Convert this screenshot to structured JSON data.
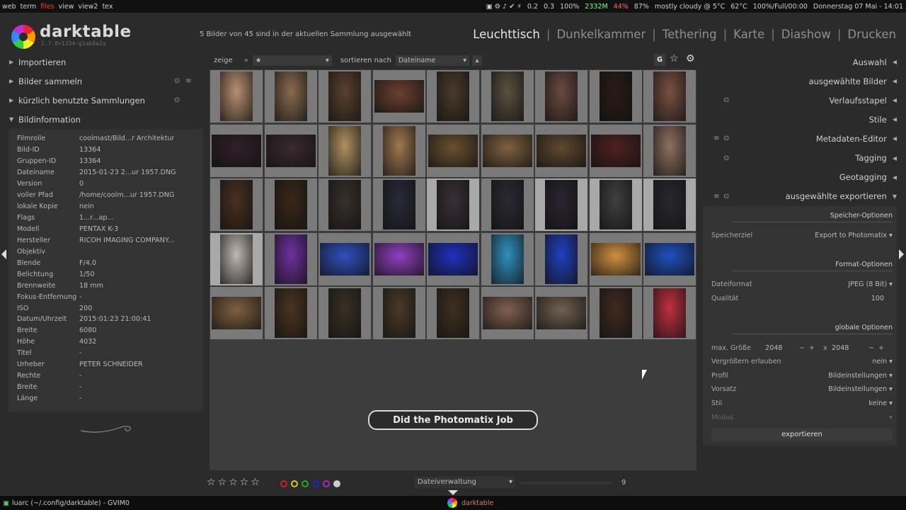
{
  "sysbar": {
    "workspaces": [
      "web",
      "term",
      "files",
      "view",
      "view2",
      "tex"
    ],
    "active_workspace": "files",
    "status": [
      "0.2",
      "0.3",
      "100%",
      "2332M",
      "44%",
      "87%",
      "mostly cloudy @ 5°C",
      "62°C",
      "100%/Full/00:00",
      "Donnerstag 07 Mai - 14:01"
    ]
  },
  "app": {
    "logo": "darktable",
    "version": "1.7.0+1334~g1ab8a2a",
    "count_text": "5 Bilder von 45 sind in der aktuellen Sammlung ausgewählt",
    "views": [
      "Leuchttisch",
      "Dunkelkammer",
      "Tethering",
      "Karte",
      "Diashow",
      "Drucken"
    ],
    "active_view": "Leuchttisch"
  },
  "left": {
    "modules": [
      {
        "label": "Importieren",
        "expanded": false
      },
      {
        "label": "Bilder sammeln",
        "expanded": false
      },
      {
        "label": "kürzlich benutzte Sammlungen",
        "expanded": false
      },
      {
        "label": "Bildinformation",
        "expanded": true
      }
    ],
    "info": [
      {
        "k": "Filmrolle",
        "v": "coolmast/Bild...r Architektur"
      },
      {
        "k": "Bild-ID",
        "v": "13364"
      },
      {
        "k": "Gruppen-ID",
        "v": "13364"
      },
      {
        "k": "Dateiname",
        "v": "2015-01-23 2...ur 1957.DNG"
      },
      {
        "k": "Version",
        "v": "0"
      },
      {
        "k": "voller Pfad",
        "v": "/home/coolm...ur 1957.DNG"
      },
      {
        "k": "lokale Kopie",
        "v": "nein"
      },
      {
        "k": "Flags",
        "v": "1...r...ap..."
      },
      {
        "k": "Modell",
        "v": "PENTAX K-3"
      },
      {
        "k": "Hersteller",
        "v": "RICOH IMAGING COMPANY..."
      },
      {
        "k": "Objektiv",
        "v": ""
      },
      {
        "k": "Blende",
        "v": "F/4.0"
      },
      {
        "k": "Belichtung",
        "v": "1/50"
      },
      {
        "k": "Brennweite",
        "v": "18 mm"
      },
      {
        "k": "Fokus-Entfernung",
        "v": "-"
      },
      {
        "k": "ISO",
        "v": "200"
      },
      {
        "k": "Datum/Uhrzeit",
        "v": "2015:01:23 21:00:41"
      },
      {
        "k": "Breite",
        "v": "6080"
      },
      {
        "k": "Höhe",
        "v": "4032"
      },
      {
        "k": "Titel",
        "v": "-"
      },
      {
        "k": "Urheber",
        "v": "PETER SCHNEIDER"
      },
      {
        "k": "Rechte",
        "v": "-"
      },
      {
        "k": "Breite",
        "v": "-"
      },
      {
        "k": "Länge",
        "v": "-"
      }
    ]
  },
  "filter": {
    "show_label": "zeige",
    "show_value": "★",
    "sort_label": "sortieren nach",
    "sort_value": "Dateiname",
    "grouping_button": "G"
  },
  "grid": {
    "columns": 9,
    "rows": 5,
    "tones": [
      [
        "#b89070",
        "#8a6a50",
        "#5a4030",
        "#6a4030",
        "#4a3a2a",
        "#5a5040",
        "#6a4a40",
        "#2a1a14",
        "#7a5040"
      ],
      [
        "#302028",
        "#3a2a30",
        "#b09060",
        "#a07850",
        "#6a5030",
        "#806040",
        "#604830",
        "#502020",
        "#907060"
      ],
      [
        "#4a3020",
        "#3a2818",
        "#38302a",
        "#2a2a3a",
        "#3a3038",
        "#2a2a34",
        "#2a2430",
        "#404040",
        "#2a2830"
      ],
      [
        "#c0b8b0",
        "#7030a0",
        "#3050c0",
        "#9040c0",
        "#2030c0",
        "#3090c0",
        "#2040c0",
        "#d09040",
        "#2050c0"
      ],
      [
        "#806040",
        "#4a3420",
        "#3a3024",
        "#4a3a28",
        "#403020",
        "#806050",
        "#706050",
        "#402a20",
        "#c03040"
      ]
    ],
    "portrait": [
      [
        true,
        true,
        true,
        false,
        true,
        true,
        true,
        true,
        true
      ],
      [
        false,
        false,
        true,
        true,
        false,
        false,
        false,
        false,
        true
      ],
      [
        true,
        true,
        true,
        true,
        true,
        true,
        true,
        true,
        true
      ],
      [
        true,
        true,
        false,
        false,
        false,
        true,
        true,
        false,
        false
      ],
      [
        false,
        true,
        true,
        true,
        true,
        false,
        false,
        true,
        true
      ]
    ],
    "selected": [
      [
        2,
        4
      ],
      [
        2,
        6
      ],
      [
        2,
        7
      ],
      [
        2,
        8
      ],
      [
        3,
        0
      ]
    ]
  },
  "overlay_text": "Did the Photomatix Job",
  "bottom": {
    "stars": "☆☆☆☆☆",
    "color_labels": [
      "#cc2222",
      "#cccc22",
      "#22aa22",
      "#2222cc",
      "#aa22cc",
      "#cccccc"
    ],
    "layout_value": "Dateiverwaltung",
    "zoom_value": "9"
  },
  "right": {
    "modules": [
      {
        "label": "Auswahl",
        "icons": ""
      },
      {
        "label": "ausgewählte Bilder",
        "icons": ""
      },
      {
        "label": "Verlaufsstapel",
        "icons": "dot"
      },
      {
        "label": "Stile",
        "icons": ""
      },
      {
        "label": "Metadaten-Editor",
        "icons": "both"
      },
      {
        "label": "Tagging",
        "icons": "dot"
      },
      {
        "label": "Geotagging",
        "icons": ""
      },
      {
        "label": "ausgewählte exportieren",
        "icons": "both",
        "expanded": true
      }
    ],
    "export": {
      "storage_section": "Speicher-Optionen",
      "target_label": "Speicherziel",
      "target_value": "Export to Photomatix",
      "format_section": "Format-Optionen",
      "format_label": "Dateiformat",
      "format_value": "JPEG (8 Bit)",
      "quality_label": "Qualität",
      "quality_value": "100",
      "global_section": "globale Optionen",
      "maxsize_label": "max. Größe",
      "maxsize_w": "2048",
      "maxsize_x": "x",
      "maxsize_h": "2048",
      "upscale_label": "Vergrößern erlauben",
      "upscale_value": "nein",
      "profile_label": "Profil",
      "profile_value": "Bildeinstellungen",
      "intent_label": "Vorsatz",
      "intent_value": "Bildeinstellungen",
      "style_label": "Stil",
      "style_value": "keine",
      "mode_label": "Modus",
      "export_button": "exportieren"
    }
  },
  "taskbar": {
    "left": "luarc (~/.config/darktable) - GVIM0",
    "center": "darktable"
  }
}
